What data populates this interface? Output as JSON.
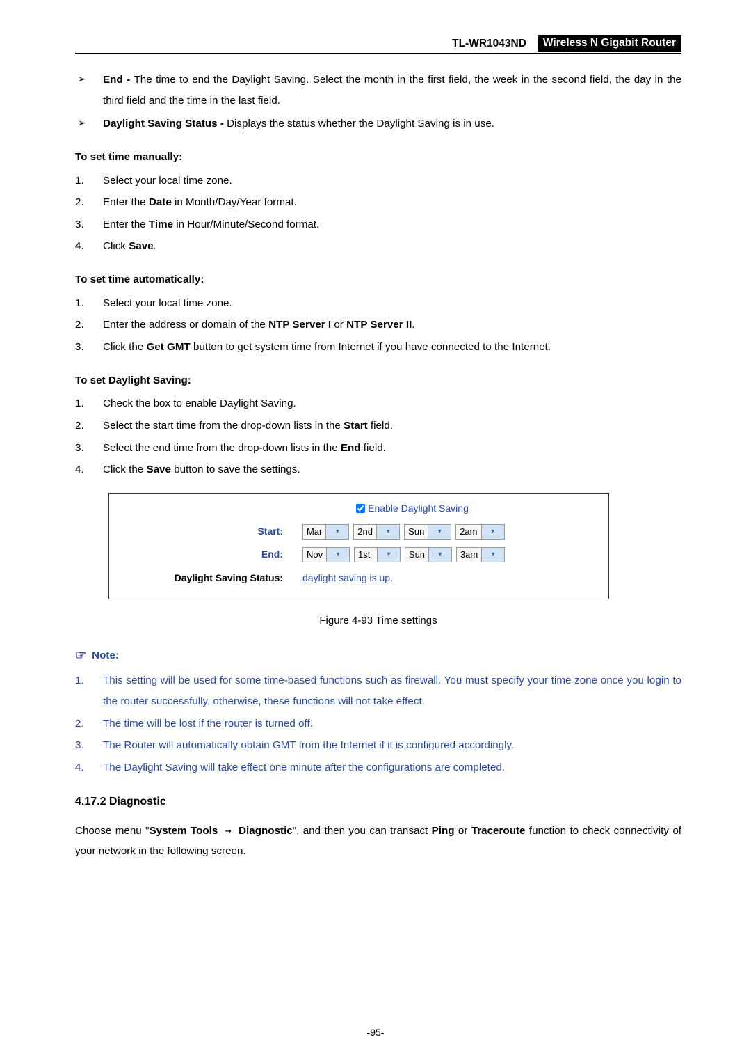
{
  "header": {
    "model": "TL-WR1043ND",
    "title": "Wireless N Gigabit Router"
  },
  "bullets": {
    "end_label": "End - ",
    "end_text": "The time to end the Daylight Saving. Select the month in the first field, the week in the second field, the day in the third field and the time in the last field.",
    "dss_label": "Daylight Saving Status - ",
    "dss_text": "Displays the status whether the Daylight Saving is in use."
  },
  "manual": {
    "heading": "To set time manually:",
    "s1": "Select your local time zone.",
    "s2_a": "Enter the ",
    "s2_b": "Date",
    "s2_c": " in Month/Day/Year format.",
    "s3_a": "Enter the ",
    "s3_b": "Time",
    "s3_c": " in Hour/Minute/Second format.",
    "s4_a": "Click ",
    "s4_b": "Save",
    "s4_c": "."
  },
  "auto": {
    "heading": "To set time automatically:",
    "s1": "Select your local time zone.",
    "s2_a": "Enter the address or domain of the ",
    "s2_b": "NTP Server I",
    "s2_c": " or ",
    "s2_d": "NTP Server II",
    "s2_e": ".",
    "s3_a": "Click the ",
    "s3_b": "Get GMT",
    "s3_c": " button to get system time from Internet if you have connected to the Internet."
  },
  "dls": {
    "heading": "To set Daylight Saving:",
    "s1": "Check the box to enable Daylight Saving.",
    "s2_a": "Select the start time from the drop-down lists in the ",
    "s2_b": "Start",
    "s2_c": " field.",
    "s3_a": "Select the end time from the drop-down lists in the ",
    "s3_b": "End",
    "s3_c": " field.",
    "s4_a": "Click the ",
    "s4_b": "Save",
    "s4_c": " button to save the settings."
  },
  "figure": {
    "enable_label": "Enable Daylight Saving",
    "start_label": "Start:",
    "end_label": "End:",
    "status_label": "Daylight Saving Status:",
    "status_value": "daylight saving is up.",
    "start_vals": [
      "Mar",
      "2nd",
      "Sun",
      "2am"
    ],
    "end_vals": [
      "Nov",
      "1st",
      "Sun",
      "3am"
    ],
    "caption": "Figure 4-93    Time settings"
  },
  "note": {
    "heading": "Note:",
    "n1": "This setting will be used for some time-based functions such as firewall. You must specify your time zone once you login to the router successfully, otherwise, these functions will not take effect.",
    "n2": "The time will be lost if the router is turned off.",
    "n3": "The Router will automatically obtain GMT from the Internet if it is configured accordingly.",
    "n4": "The Daylight Saving will take effect one minute after the configurations are completed."
  },
  "section": {
    "heading": "4.17.2  Diagnostic",
    "p_a": "Choose menu \"",
    "p_b": "System Tools",
    "p_c": " → ",
    "p_d": "Diagnostic",
    "p_e": "\", and then you can transact ",
    "p_f": "Ping",
    "p_g": " or ",
    "p_h": "Traceroute",
    "p_i": " function to check connectivity of your network in the following screen."
  },
  "page_number": "-95-"
}
